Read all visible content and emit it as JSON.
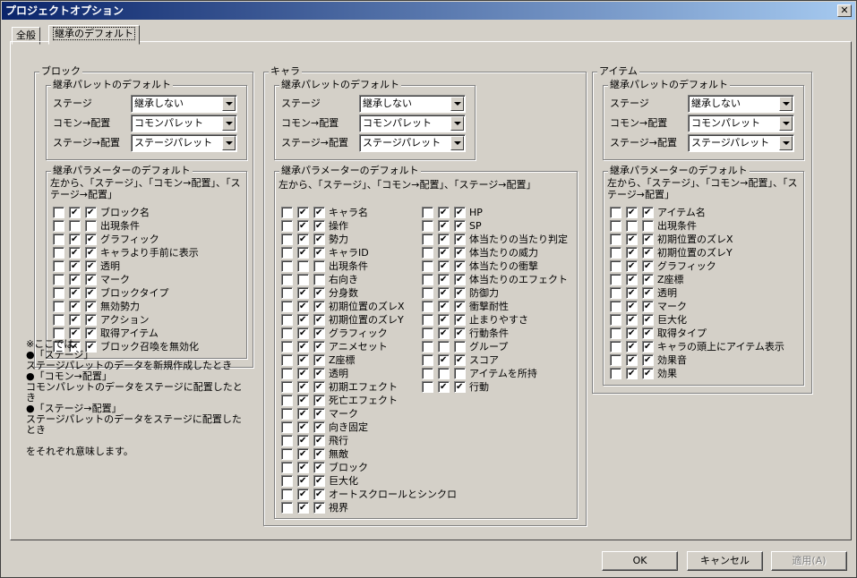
{
  "title": "プロジェクトオプション",
  "tabs": [
    "全般",
    "継承のデフォルト"
  ],
  "panels": [
    {
      "title": "ブロック",
      "palette_group": "継承パレットのデフォルト",
      "combos": [
        {
          "label": "ステージ",
          "value": "継承しない"
        },
        {
          "label": "コモン→配置",
          "value": "コモンパレット"
        },
        {
          "label": "ステージ→配置",
          "value": "ステージパレット"
        }
      ],
      "param_group": "継承パラメーターのデフォルト",
      "desc": "左から、「ステージ」、「コモン→配置」、「ス\nテージ→配置」",
      "items": [
        {
          "l": "ブロック名",
          "c": [
            0,
            1,
            1
          ]
        },
        {
          "l": "出現条件",
          "c": [
            0,
            0,
            0
          ]
        },
        {
          "l": "グラフィック",
          "c": [
            0,
            1,
            1
          ]
        },
        {
          "l": "キャラより手前に表示",
          "c": [
            0,
            1,
            1
          ]
        },
        {
          "l": "透明",
          "c": [
            0,
            1,
            1
          ]
        },
        {
          "l": "マーク",
          "c": [
            0,
            1,
            1
          ]
        },
        {
          "l": "ブロックタイプ",
          "c": [
            0,
            1,
            1
          ]
        },
        {
          "l": "無効勢力",
          "c": [
            0,
            1,
            1
          ]
        },
        {
          "l": "アクション",
          "c": [
            0,
            1,
            1
          ]
        },
        {
          "l": "取得アイテム",
          "c": [
            0,
            1,
            1
          ]
        },
        {
          "l": "ブロック召喚を無効化",
          "c": [
            0,
            1,
            1
          ]
        }
      ]
    },
    {
      "title": "キャラ",
      "palette_group": "継承パレットのデフォルト",
      "combos": [
        {
          "label": "ステージ",
          "value": "継承しない"
        },
        {
          "label": "コモン→配置",
          "value": "コモンパレット"
        },
        {
          "label": "ステージ→配置",
          "value": "ステージパレット"
        }
      ],
      "param_group": "継承パラメーターのデフォルト",
      "desc": "左から、「ステージ」、「コモン→配置」、「ステージ→配置」",
      "items": [
        {
          "l": "キャラ名",
          "c": [
            0,
            1,
            1
          ]
        },
        {
          "l": "操作",
          "c": [
            0,
            1,
            1
          ]
        },
        {
          "l": "勢力",
          "c": [
            0,
            1,
            1
          ]
        },
        {
          "l": "キャラID",
          "c": [
            0,
            1,
            1
          ]
        },
        {
          "l": "出現条件",
          "c": [
            0,
            0,
            0
          ]
        },
        {
          "l": "右向き",
          "c": [
            0,
            0,
            0
          ]
        },
        {
          "l": "分身数",
          "c": [
            0,
            1,
            1
          ]
        },
        {
          "l": "初期位置のズレX",
          "c": [
            0,
            1,
            1
          ]
        },
        {
          "l": "初期位置のズレY",
          "c": [
            0,
            1,
            1
          ]
        },
        {
          "l": "グラフィック",
          "c": [
            0,
            1,
            1
          ]
        },
        {
          "l": "アニメセット",
          "c": [
            0,
            1,
            1
          ]
        },
        {
          "l": "Z座標",
          "c": [
            0,
            1,
            1
          ]
        },
        {
          "l": "透明",
          "c": [
            0,
            1,
            1
          ]
        },
        {
          "l": "初期エフェクト",
          "c": [
            0,
            1,
            1
          ]
        },
        {
          "l": "死亡エフェクト",
          "c": [
            0,
            1,
            1
          ]
        },
        {
          "l": "マーク",
          "c": [
            0,
            1,
            1
          ]
        },
        {
          "l": "向き固定",
          "c": [
            0,
            1,
            1
          ]
        },
        {
          "l": "飛行",
          "c": [
            0,
            1,
            1
          ]
        },
        {
          "l": "無敵",
          "c": [
            0,
            1,
            1
          ]
        },
        {
          "l": "ブロック",
          "c": [
            0,
            1,
            1
          ]
        },
        {
          "l": "巨大化",
          "c": [
            0,
            1,
            1
          ]
        },
        {
          "l": "オートスクロールとシンクロ",
          "c": [
            0,
            1,
            1
          ]
        },
        {
          "l": "視界",
          "c": [
            0,
            1,
            1
          ]
        }
      ],
      "items2": [
        {
          "l": "HP",
          "c": [
            0,
            1,
            1
          ]
        },
        {
          "l": "SP",
          "c": [
            0,
            1,
            1
          ]
        },
        {
          "l": "体当たりの当たり判定",
          "c": [
            0,
            1,
            1
          ]
        },
        {
          "l": "体当たりの威力",
          "c": [
            0,
            1,
            1
          ]
        },
        {
          "l": "体当たりの衝撃",
          "c": [
            0,
            1,
            1
          ]
        },
        {
          "l": "体当たりのエフェクト",
          "c": [
            0,
            1,
            1
          ]
        },
        {
          "l": "防御力",
          "c": [
            0,
            1,
            1
          ]
        },
        {
          "l": "衝撃耐性",
          "c": [
            0,
            1,
            1
          ]
        },
        {
          "l": "止まりやすさ",
          "c": [
            0,
            1,
            1
          ]
        },
        {
          "l": "行動条件",
          "c": [
            0,
            1,
            1
          ]
        },
        {
          "l": "グループ",
          "c": [
            0,
            0,
            0
          ]
        },
        {
          "l": "スコア",
          "c": [
            0,
            1,
            1
          ]
        },
        {
          "l": "アイテムを所持",
          "c": [
            0,
            0,
            0
          ]
        },
        {
          "l": "行動",
          "c": [
            0,
            1,
            1
          ]
        }
      ]
    },
    {
      "title": "アイテム",
      "palette_group": "継承パレットのデフォルト",
      "combos": [
        {
          "label": "ステージ",
          "value": "継承しない"
        },
        {
          "label": "コモン→配置",
          "value": "コモンパレット"
        },
        {
          "label": "ステージ→配置",
          "value": "ステージパレット"
        }
      ],
      "param_group": "継承パラメーターのデフォルト",
      "desc": "左から、「ステージ」、「コモン→配置」、「ス\nテージ→配置」",
      "items": [
        {
          "l": "アイテム名",
          "c": [
            0,
            1,
            1
          ]
        },
        {
          "l": "出現条件",
          "c": [
            0,
            0,
            0
          ]
        },
        {
          "l": "初期位置のズレX",
          "c": [
            0,
            1,
            1
          ]
        },
        {
          "l": "初期位置のズレY",
          "c": [
            0,
            1,
            1
          ]
        },
        {
          "l": "グラフィック",
          "c": [
            0,
            1,
            1
          ]
        },
        {
          "l": "Z座標",
          "c": [
            0,
            1,
            1
          ]
        },
        {
          "l": "透明",
          "c": [
            0,
            1,
            1
          ]
        },
        {
          "l": "マーク",
          "c": [
            0,
            1,
            1
          ]
        },
        {
          "l": "巨大化",
          "c": [
            0,
            1,
            1
          ]
        },
        {
          "l": "取得タイプ",
          "c": [
            0,
            1,
            1
          ]
        },
        {
          "l": "キャラの頭上にアイテム表示",
          "c": [
            0,
            1,
            1
          ]
        },
        {
          "l": "効果音",
          "c": [
            0,
            1,
            1
          ]
        },
        {
          "l": "効果",
          "c": [
            0,
            1,
            1
          ]
        }
      ]
    }
  ],
  "note": [
    "※ここでは、",
    "●「ステージ」",
    "ステージパレットのデータを新規作成したとき",
    "●「コモン→配置」",
    "コモンパレットのデータをステージに配置したとき",
    "●「ステージ→配置」",
    "ステージパレットのデータをステージに配置したとき",
    "",
    "をそれぞれ意味します。"
  ],
  "buttons": {
    "ok": "OK",
    "cancel": "キャンセル",
    "apply": "適用(A)"
  }
}
